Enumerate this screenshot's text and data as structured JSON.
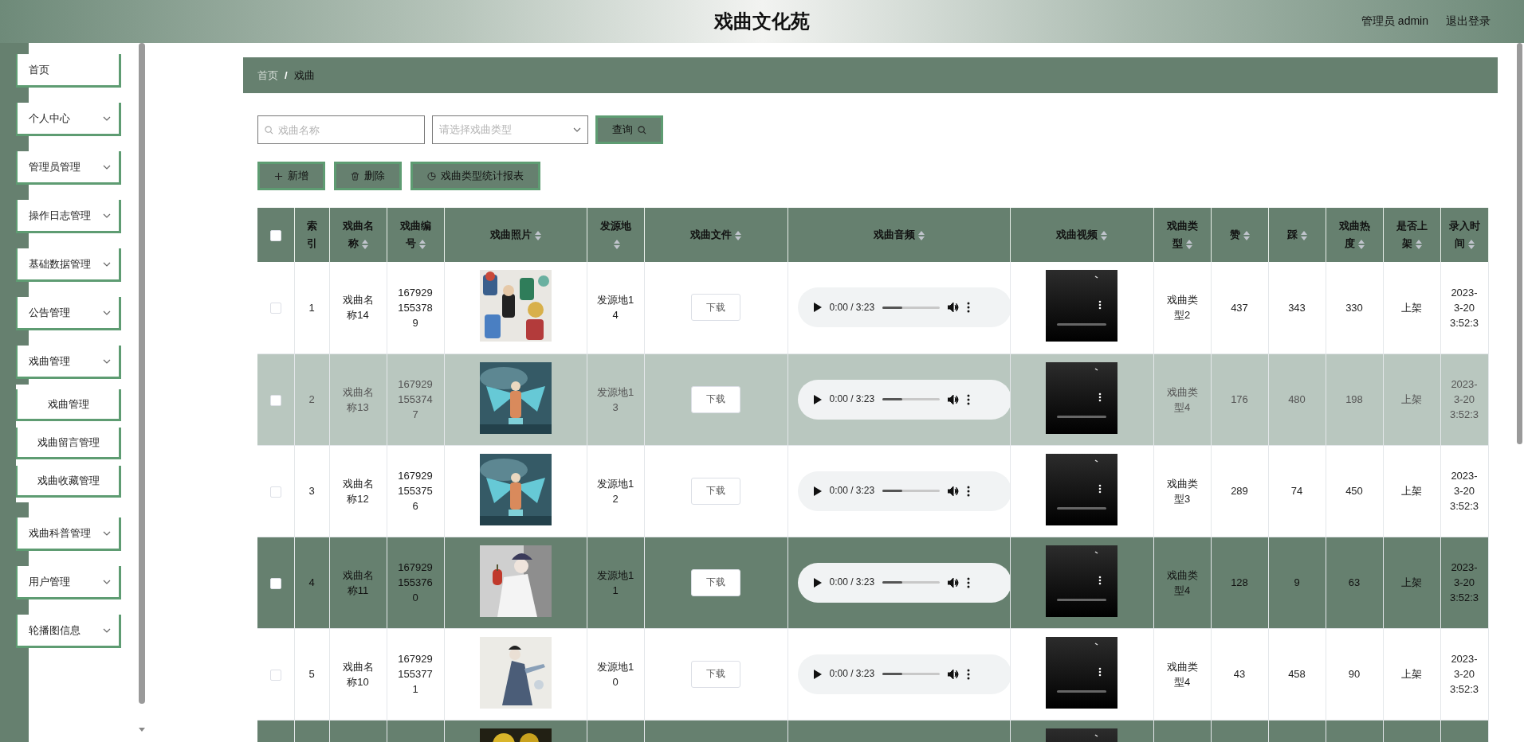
{
  "header": {
    "title": "戏曲文化苑",
    "user": "管理员 admin",
    "logout": "退出登录"
  },
  "sidebar": {
    "items": [
      {
        "label": "首页",
        "kind": "link"
      },
      {
        "label": "个人中心",
        "kind": "submenu"
      },
      {
        "label": "管理员管理",
        "kind": "submenu"
      },
      {
        "label": "操作日志管理",
        "kind": "submenu"
      },
      {
        "label": "基础数据管理",
        "kind": "submenu"
      },
      {
        "label": "公告管理",
        "kind": "submenu"
      },
      {
        "label": "戏曲管理",
        "kind": "submenu",
        "children": [
          {
            "label": "戏曲管理"
          },
          {
            "label": "戏曲留言管理"
          },
          {
            "label": "戏曲收藏管理"
          }
        ]
      },
      {
        "label": "戏曲科普管理",
        "kind": "submenu"
      },
      {
        "label": "用户管理",
        "kind": "submenu"
      },
      {
        "label": "轮播图信息",
        "kind": "submenu"
      }
    ]
  },
  "breadcrumb": {
    "items": [
      "首页",
      "戏曲"
    ],
    "separator": "/"
  },
  "search": {
    "name_placeholder": "戏曲名称",
    "type_placeholder": "请选择戏曲类型",
    "button": "查询"
  },
  "actions": [
    {
      "label": "新增",
      "kind": "add"
    },
    {
      "label": "删除",
      "kind": "delete"
    },
    {
      "label": "戏曲类型统计报表",
      "kind": "chart"
    }
  ],
  "table": {
    "all_checked": false,
    "columns": [
      {
        "label": "索引",
        "sortable": false
      },
      {
        "label": "戏曲名称",
        "sortable": true
      },
      {
        "label": "戏曲编号",
        "sortable": true
      },
      {
        "label": "戏曲照片",
        "sortable": true
      },
      {
        "label": "发源地",
        "sortable": true
      },
      {
        "label": "戏曲文件",
        "sortable": true
      },
      {
        "label": "戏曲音频",
        "sortable": true
      },
      {
        "label": "戏曲视频",
        "sortable": true
      },
      {
        "label": "戏曲类型",
        "sortable": true
      },
      {
        "label": "赞",
        "sortable": true
      },
      {
        "label": "踩",
        "sortable": true
      },
      {
        "label": "戏曲热度",
        "sortable": true
      },
      {
        "label": "是否上架",
        "sortable": true
      },
      {
        "label": "录入时间",
        "sortable": true
      }
    ],
    "rows": [
      {
        "kind": "plain",
        "checked": false,
        "index": "1",
        "name": "戏曲名称14",
        "code": "1679291553789",
        "origin": "发源地14",
        "file_button": "下载",
        "audio": {
          "time": "0:00 / 3:23",
          "level": 0.35
        },
        "type": "戏曲类型2",
        "likes": "437",
        "dislikes": "343",
        "heat": "330",
        "status": "上架",
        "time_lines": [
          "2023-",
          "3-20",
          "3:52:3"
        ]
      },
      {
        "kind": "hover",
        "checked": false,
        "index": "2",
        "name": "戏曲名称13",
        "code": "1679291553747",
        "origin": "发源地13",
        "file_button": "下载",
        "audio": {
          "time": "0:00 / 3:23",
          "level": 0.35
        },
        "type": "戏曲类型4",
        "likes": "176",
        "dislikes": "480",
        "heat": "198",
        "status": "上架",
        "time_lines": [
          "2023-",
          "3-20",
          "3:52:3"
        ]
      },
      {
        "kind": "plain",
        "checked": false,
        "index": "3",
        "name": "戏曲名称12",
        "code": "1679291553756",
        "origin": "发源地12",
        "file_button": "下载",
        "audio": {
          "time": "0:00 / 3:23",
          "level": 0.35
        },
        "type": "戏曲类型3",
        "likes": "289",
        "dislikes": "74",
        "heat": "450",
        "status": "上架",
        "time_lines": [
          "2023-",
          "3-20",
          "3:52:3"
        ]
      },
      {
        "kind": "striped",
        "checked": false,
        "index": "4",
        "name": "戏曲名称11",
        "code": "1679291553760",
        "origin": "发源地11",
        "file_button": "下载",
        "audio": {
          "time": "0:00 / 3:23",
          "level": 0.35
        },
        "type": "戏曲类型4",
        "likes": "128",
        "dislikes": "9",
        "heat": "63",
        "status": "上架",
        "time_lines": [
          "2023-",
          "3-20",
          "3:52:3"
        ]
      },
      {
        "kind": "plain",
        "checked": false,
        "index": "5",
        "name": "戏曲名称10",
        "code": "1679291553771",
        "origin": "发源地10",
        "file_button": "下载",
        "audio": {
          "time": "0:00 / 3:23",
          "level": 0.35
        },
        "type": "戏曲类型4",
        "likes": "43",
        "dislikes": "458",
        "heat": "90",
        "status": "上架",
        "time_lines": [
          "2023-",
          "3-20",
          "3:52:3"
        ]
      },
      {
        "kind": "striped"
      }
    ]
  }
}
